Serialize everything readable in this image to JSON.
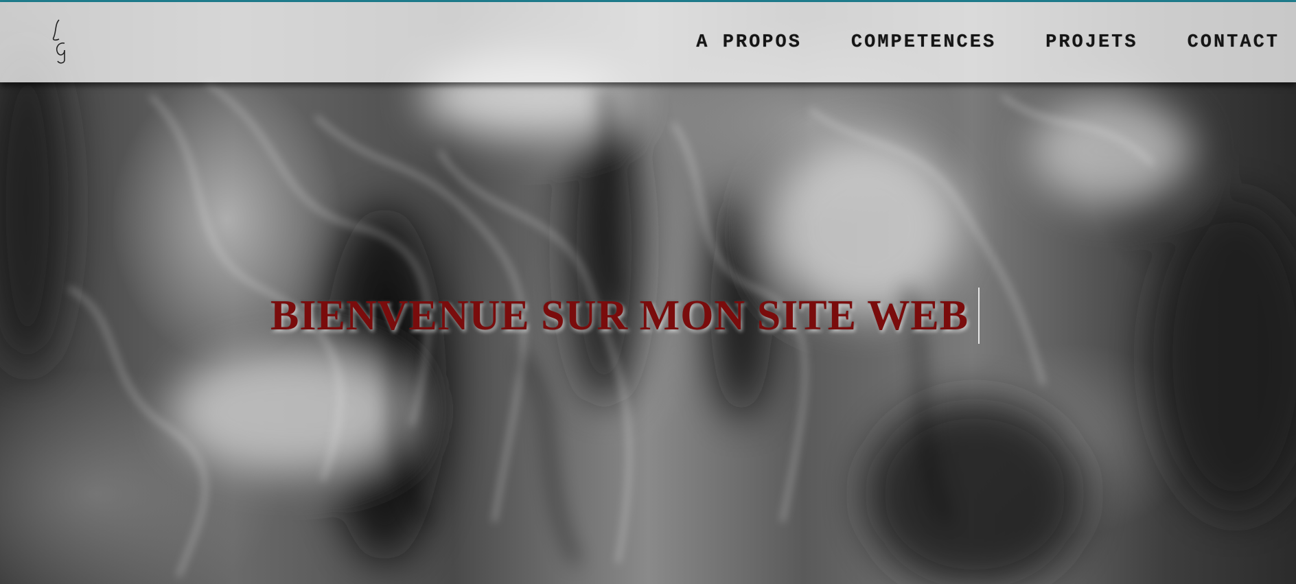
{
  "logo": {
    "icon": "monogram-logo-icon"
  },
  "nav": {
    "items": [
      {
        "label": "A PROPOS"
      },
      {
        "label": "COMPETENCES"
      },
      {
        "label": "PROJETS"
      },
      {
        "label": "CONTACT"
      }
    ]
  },
  "hero": {
    "title": "BIENVENUE SUR MON SITE WEB"
  },
  "colors": {
    "accent_top_line": "#1f7f8f",
    "title": "#7a0c0c",
    "navbar_bg": "#f5f5f5"
  }
}
